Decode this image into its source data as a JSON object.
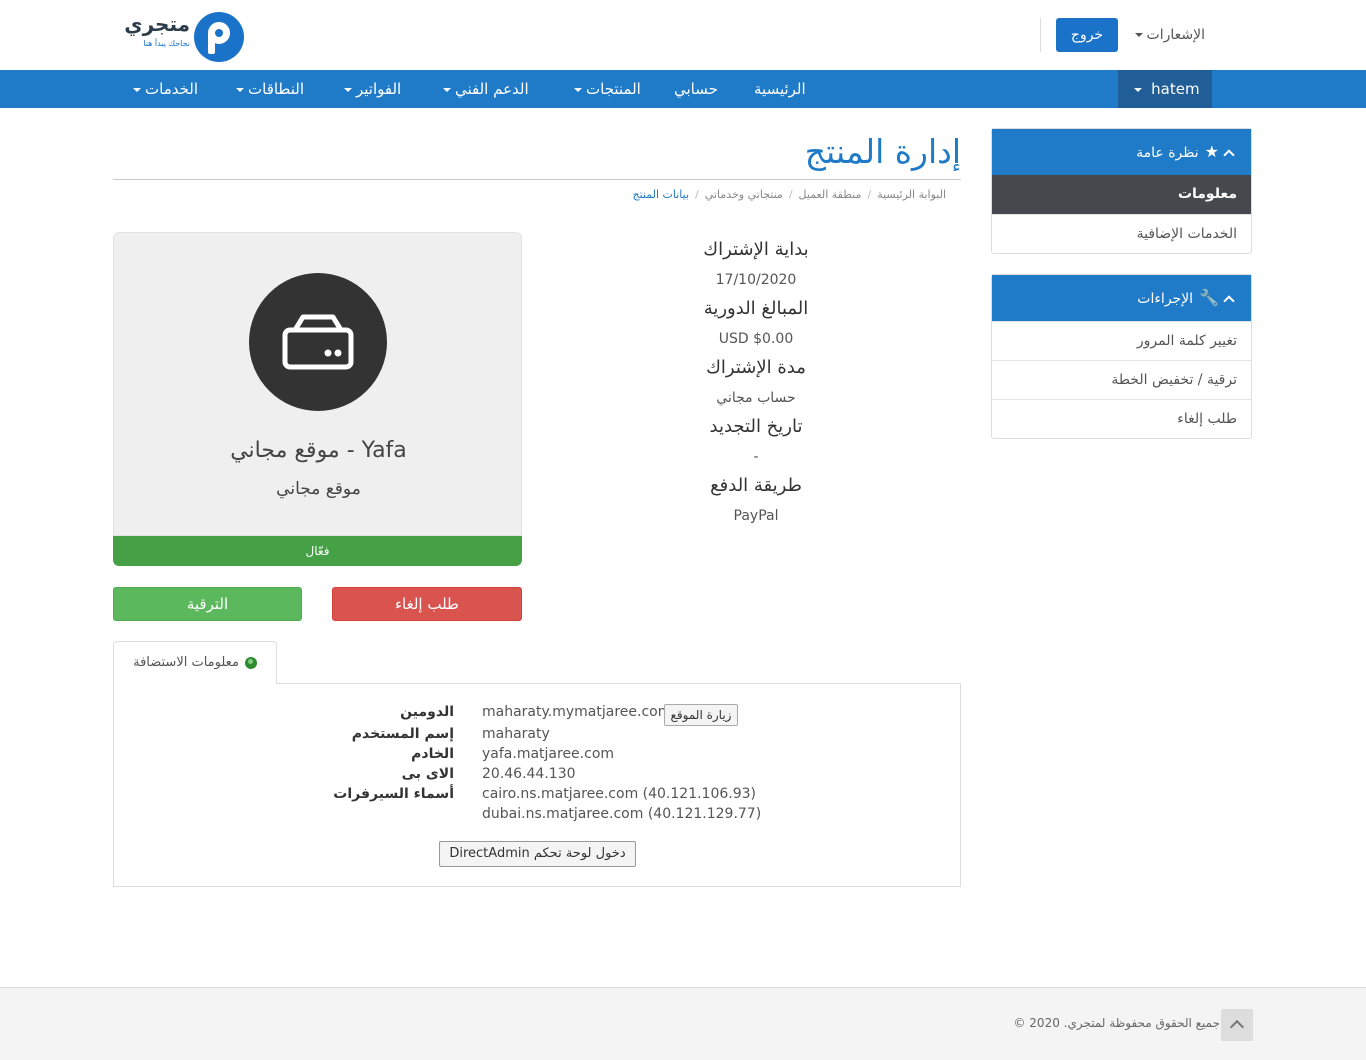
{
  "header": {
    "logo_text": "متجري",
    "logo_tagline": "نجاحك يبدأ هنا",
    "logout_label": "خروج",
    "notifications_label": "الإشعارات"
  },
  "nav": {
    "user": "hatem",
    "items": [
      {
        "label": "الرئيسية",
        "dropdown": false
      },
      {
        "label": "حسابي",
        "dropdown": false
      },
      {
        "label": "المنتجات",
        "dropdown": true
      },
      {
        "label": "الدعم الفني",
        "dropdown": true
      },
      {
        "label": "الفواتير",
        "dropdown": true
      },
      {
        "label": "النطاقات",
        "dropdown": true
      },
      {
        "label": "الخدمات",
        "dropdown": true
      }
    ]
  },
  "page": {
    "title": "إدارة المنتج",
    "breadcrumb": [
      "البوابة الرئيسية",
      "منطقة العميل",
      "منتجاتي وخدماتي",
      "بيانات المنتج"
    ]
  },
  "product": {
    "name": "موقع مجاني - Yafa",
    "group": "موقع مجاني",
    "status": "فعّال",
    "upgrade_label": "الترقية",
    "cancel_label": "طلب إلغاء"
  },
  "info": {
    "reg_date_label": "بداية الإشتراك",
    "reg_date": "17/10/2020",
    "recurring_label": "المبالغ الدورية",
    "recurring": "$0.00 USD",
    "cycle_label": "مدة الإشتراك",
    "cycle": "حساب مجاني",
    "next_due_label": "تاريخ التجديد",
    "next_due": "-",
    "payment_label": "طريقة الدفع",
    "payment": "PayPal"
  },
  "hosting": {
    "tab_label": "معلومات الاستضافة",
    "domain_label": "الدومين",
    "domain": "maharaty.mymatjaree.com",
    "visit_label": "زيارة الموقع",
    "username_label": "إسم المستخدم",
    "username": "maharaty",
    "server_label": "الخادم",
    "server": "yafa.matjaree.com",
    "ip_label": "الاى بى",
    "ip": "20.46.44.130",
    "ns_label": "أسماء السيرفرات",
    "ns1": "cairo.ns.matjaree.com (40.121.106.93)",
    "ns2": "dubai.ns.matjaree.com (40.121.129.77)",
    "cpanel_label": "دخول لوحة تحكم DirectAdmin"
  },
  "sidebar": {
    "overview_title": "نظرة عامة",
    "overview_items": [
      "معلومات",
      "الخدمات الإضافية"
    ],
    "actions_title": "الإجراءات",
    "actions_items": [
      "تغيير كلمة المرور",
      "ترقية / تخفيض الخطة",
      "طلب إلغاء"
    ]
  },
  "footer": {
    "copyright": "جميع الحقوق محفوظة لمتجري. 2020 ©"
  },
  "colors": {
    "primary": "#1f7ac7",
    "nav_user_bg": "#215d96",
    "status_green": "#46a046",
    "upgrade_green": "#5cb85c",
    "cancel_red": "#d9534f"
  }
}
